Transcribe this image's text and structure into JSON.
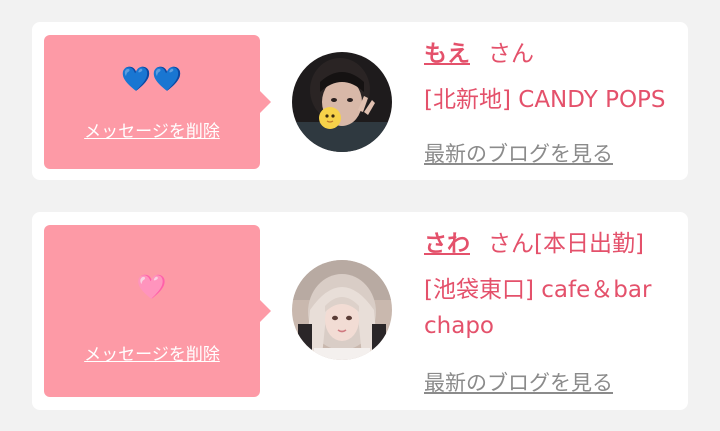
{
  "messages": [
    {
      "hearts": "💙💙",
      "delete_label": "メッセージを削除",
      "name": "もえ",
      "suffix": "さん",
      "shop": "[北新地] CANDY POPS",
      "blog_label": "最新のブログを見る",
      "heart_color": "#6ec3f5"
    },
    {
      "hearts": "🩷",
      "delete_label": "メッセージを削除",
      "name": "さわ",
      "suffix": "さん[本日出勤]",
      "shop": "[池袋東口] cafe＆bar chapo",
      "blog_label": "最新のブログを見る",
      "heart_color": "#ffb7d2"
    }
  ],
  "colors": {
    "accent": "#e4516b",
    "bubble": "#fd9aa6",
    "link_gray": "#8b8b8b",
    "background": "#f2f2f2"
  }
}
